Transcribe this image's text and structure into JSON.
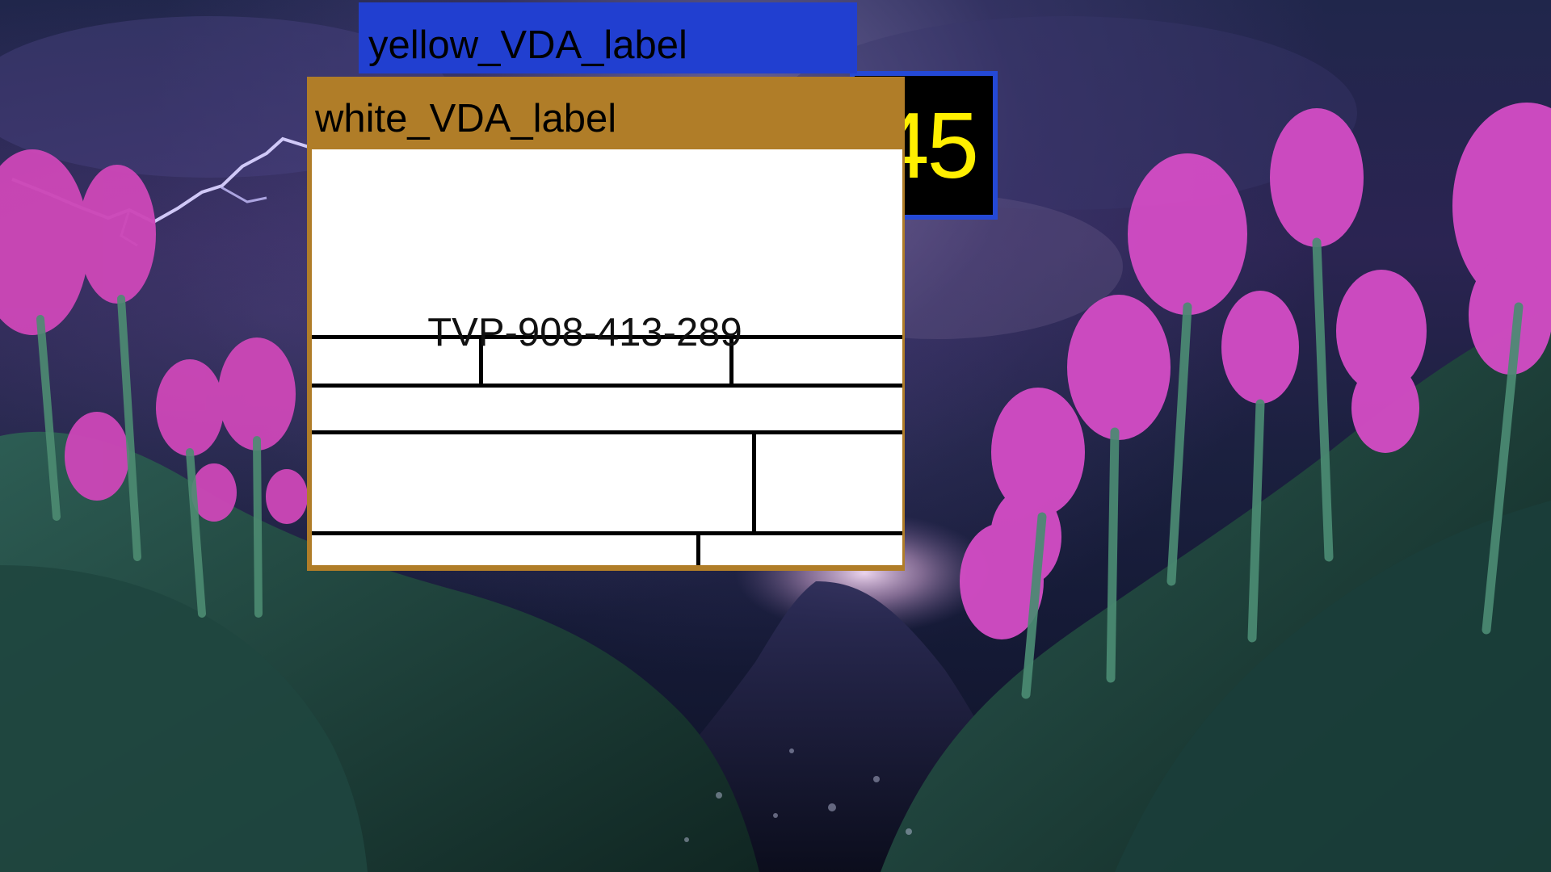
{
  "labels": {
    "yellow": "yellow_VDA_label",
    "white": "white_VDA_label"
  },
  "counter": {
    "value": "45"
  },
  "form": {
    "tracking_code": "TVP-908-413-289"
  },
  "colors": {
    "yellow_panel": "#213fd0",
    "white_panel": "#b07d28",
    "counter_text": "#ffef00",
    "counter_border": "#2449d6"
  },
  "background": {
    "icon": "tulip-field-photo"
  }
}
